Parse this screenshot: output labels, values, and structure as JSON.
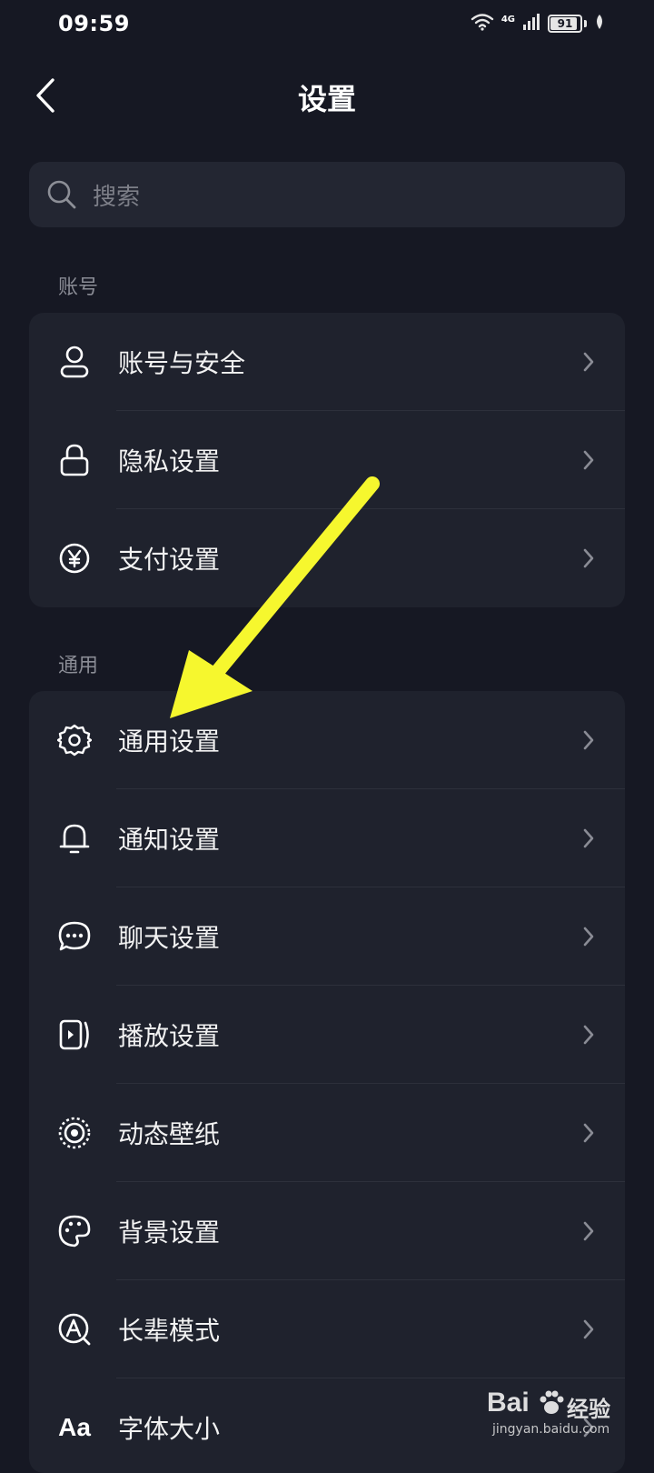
{
  "status_bar": {
    "time": "09:59",
    "network": "4G",
    "battery": "91",
    "battery_level": 0.91
  },
  "header": {
    "title": "设置"
  },
  "search": {
    "placeholder": "搜索"
  },
  "sections": [
    {
      "label": "账号",
      "items": [
        {
          "label": "账号与安全",
          "icon": "user-icon"
        },
        {
          "label": "隐私设置",
          "icon": "lock-icon"
        },
        {
          "label": "支付设置",
          "icon": "yen-icon"
        }
      ]
    },
    {
      "label": "通用",
      "items": [
        {
          "label": "通用设置",
          "icon": "gear-icon"
        },
        {
          "label": "通知设置",
          "icon": "bell-icon"
        },
        {
          "label": "聊天设置",
          "icon": "chat-bubble-icon"
        },
        {
          "label": "播放设置",
          "icon": "play-device-icon"
        },
        {
          "label": "动态壁纸",
          "icon": "live-wallpaper-icon"
        },
        {
          "label": "背景设置",
          "icon": "palette-icon"
        },
        {
          "label": "长辈模式",
          "icon": "elder-mode-icon"
        },
        {
          "label": "字体大小",
          "icon": "font-size-icon"
        }
      ]
    }
  ],
  "annotation": {
    "color": "#f6f72e"
  },
  "watermark": {
    "brand": "Bai",
    "cn": "经验",
    "url": "jingyan.baidu.com"
  },
  "colors": {
    "background": "#161823",
    "card": "#1f222d",
    "text": "#f2f2f2",
    "muted": "#8a8c95"
  }
}
